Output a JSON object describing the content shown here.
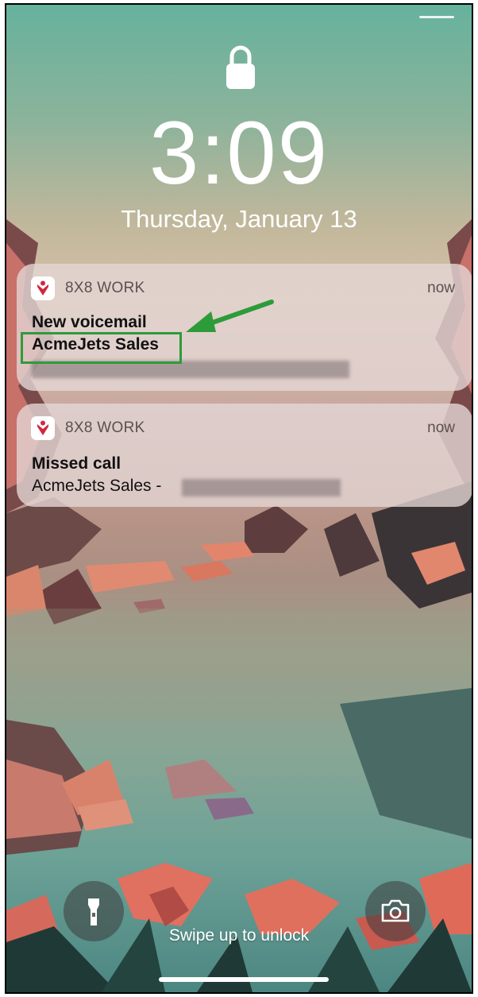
{
  "lock_screen": {
    "time": "3:09",
    "date": "Thursday, January 13",
    "swipe_hint": "Swipe up to unlock"
  },
  "notifications": [
    {
      "app_name": "8X8 WORK",
      "time": "now",
      "title": "New voicemail",
      "subtitle": "AcmeJets Sales",
      "icon": "8x8-app-icon"
    },
    {
      "app_name": "8X8 WORK",
      "time": "now",
      "title": "Missed call",
      "body": "AcmeJets Sales -",
      "icon": "8x8-app-icon"
    }
  ],
  "quick_actions": {
    "left_icon": "flashlight-icon",
    "right_icon": "camera-icon"
  },
  "annotation": {
    "highlight_color": "#2e9b3b"
  }
}
